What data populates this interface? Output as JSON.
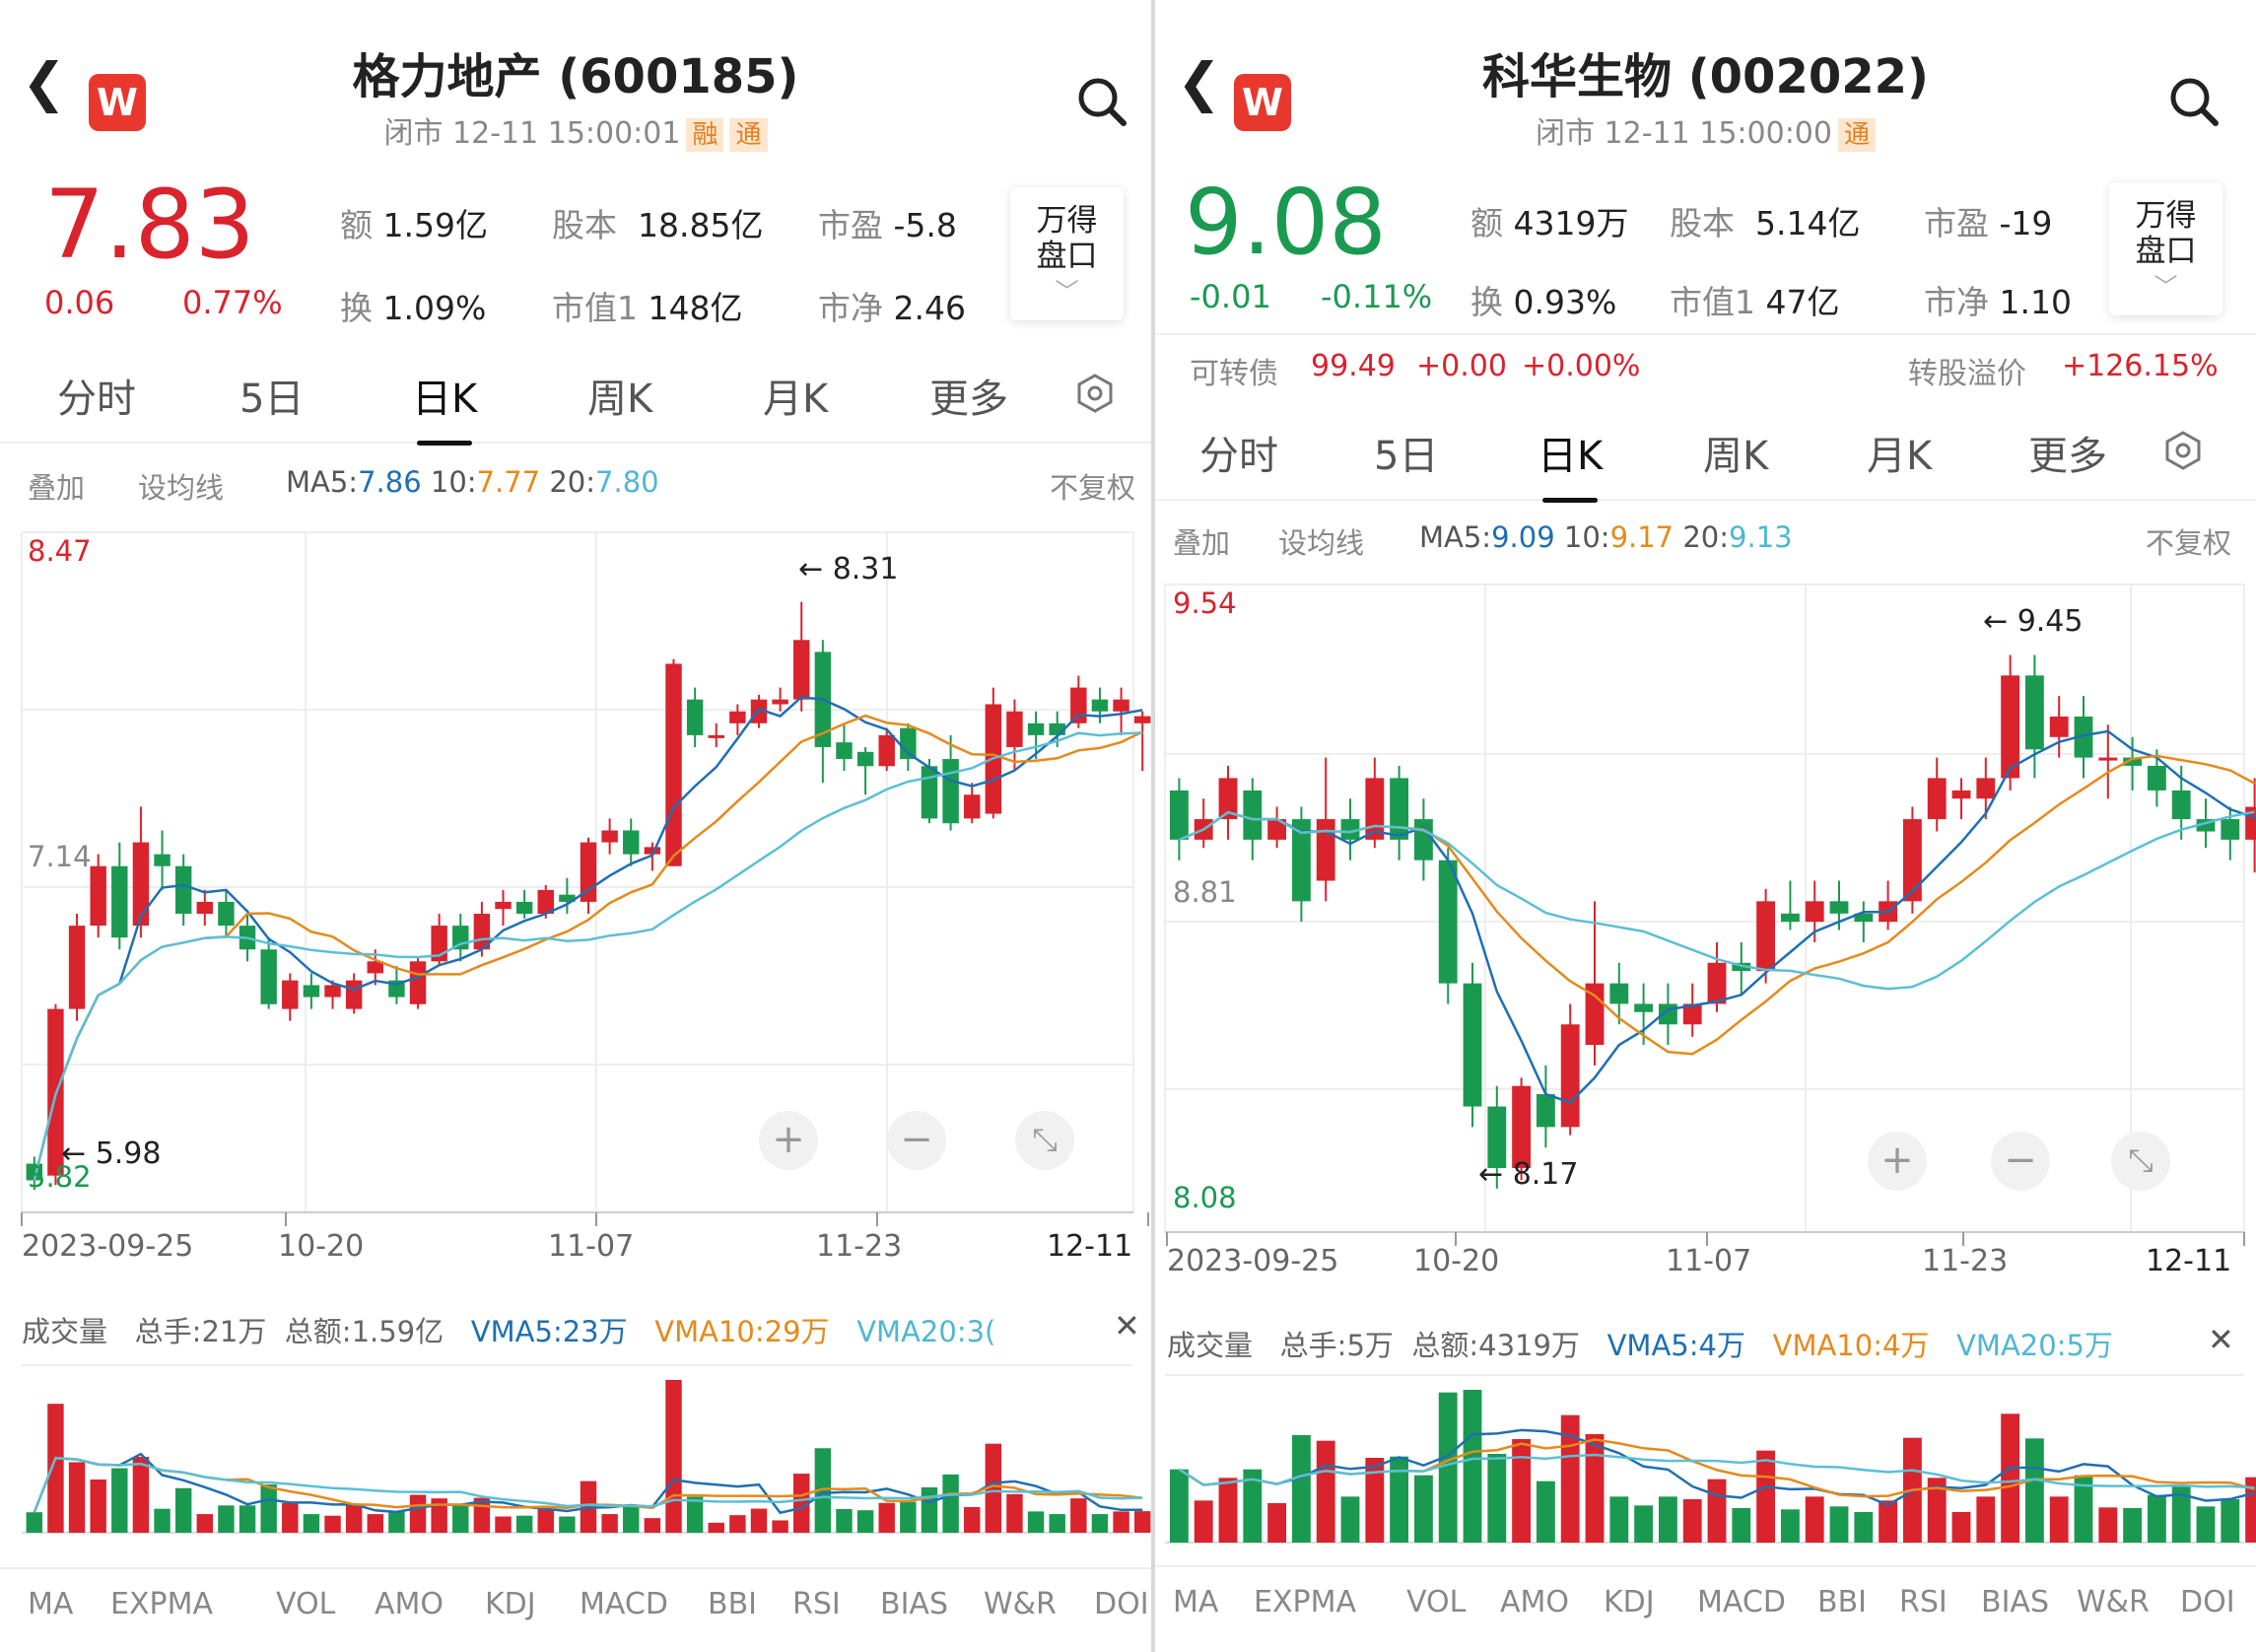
{
  "left": {
    "name": "格力地产 (600185)",
    "status": "闭市 12-11 15:00:01",
    "badges": [
      "融",
      "通"
    ],
    "price": "7.83",
    "chg": "0.06",
    "pct": "0.77%",
    "stats": [
      [
        "额",
        "1.59亿"
      ],
      [
        "股本",
        "18.85亿"
      ],
      [
        "市盈",
        "-5.8"
      ],
      [
        "换",
        "1.09%"
      ],
      [
        "市值1",
        "148亿"
      ],
      [
        "市净",
        "2.46"
      ]
    ],
    "side_btn": [
      "万得",
      "盘口"
    ],
    "tabs": [
      "分时",
      "5日",
      "日K",
      "周K",
      "月K",
      "更多"
    ],
    "sub": {
      "overlay": "叠加",
      "ma_set": "设均线",
      "ma5k": "MA5:",
      "ma5": "7.86",
      "ma10k": "10:",
      "ma10": "7.77",
      "ma20k": "20:",
      "ma20": "7.80",
      "adj": "不复权"
    },
    "axis": {
      "top": "8.47",
      "mid": "7.14",
      "bottom": "5.82"
    },
    "dates": [
      "2023-09-25",
      "10-20",
      "11-07",
      "11-23",
      "12-11"
    ],
    "annot_high": "8.31",
    "annot_low": "5.98",
    "vol": {
      "title": "成交量",
      "total": "总手:21万",
      "amount": "总额:1.59亿",
      "vma5": "VMA5:23万",
      "vma10": "VMA10:29万",
      "vma20": "VMA20:3("
    },
    "indicators": [
      "MA",
      "EXPMA",
      "VOL",
      "AMO",
      "KDJ",
      "MACD",
      "BBI",
      "RSI",
      "BIAS",
      "W&R",
      "DOI"
    ]
  },
  "right": {
    "name": "科华生物 (002022)",
    "status": "闭市 12-11 15:00:00",
    "badges": [
      "通"
    ],
    "price": "9.08",
    "chg": "-0.01",
    "pct": "-0.11%",
    "stats": [
      [
        "额",
        "4319万"
      ],
      [
        "股本",
        "5.14亿"
      ],
      [
        "市盈",
        "-19"
      ],
      [
        "换",
        "0.93%"
      ],
      [
        "市值1",
        "47亿"
      ],
      [
        "市净",
        "1.10"
      ]
    ],
    "side_btn": [
      "万得",
      "盘口"
    ],
    "bond": {
      "label": "可转债",
      "price": "99.49",
      "chg": "+0.00",
      "pct": "+0.00%",
      "prem_label": "转股溢价",
      "prem": "+126.15%"
    },
    "tabs": [
      "分时",
      "5日",
      "日K",
      "周K",
      "月K",
      "更多"
    ],
    "sub": {
      "overlay": "叠加",
      "ma_set": "设均线",
      "ma5k": "MA5:",
      "ma5": "9.09",
      "ma10k": "10:",
      "ma10": "9.17",
      "ma20k": "20:",
      "ma20": "9.13",
      "adj": "不复权"
    },
    "axis": {
      "top": "9.54",
      "mid": "8.81",
      "bottom": "8.08"
    },
    "dates": [
      "2023-09-25",
      "10-20",
      "11-07",
      "11-23",
      "12-11"
    ],
    "annot_high": "9.45",
    "annot_low": "8.17",
    "vol": {
      "title": "成交量",
      "total": "总手:5万",
      "amount": "总额:4319万",
      "vma5": "VMA5:4万",
      "vma10": "VMA10:4万",
      "vma20": "VMA20:5万"
    },
    "indicators": [
      "MA",
      "EXPMA",
      "VOL",
      "AMO",
      "KDJ",
      "MACD",
      "BBI",
      "RSI",
      "BIAS",
      "W&R",
      "DOI"
    ]
  },
  "colors": {
    "up": "#d9232d",
    "down": "#1a9a50",
    "ma5": "#1e6fb3",
    "ma10": "#e58a1b",
    "ma20": "#5bbfd6"
  },
  "chart_data": [
    {
      "type": "candlestick",
      "title": "格力地产 (600185)",
      "ylim": [
        5.82,
        8.47
      ],
      "candles": [
        [
          5.95,
          5.88,
          5.98,
          5.84
        ],
        [
          5.9,
          6.6,
          6.62,
          5.86
        ],
        [
          6.6,
          6.95,
          7.0,
          6.55
        ],
        [
          6.95,
          7.2,
          7.25,
          6.9
        ],
        [
          7.2,
          6.9,
          7.3,
          6.85
        ],
        [
          6.95,
          7.3,
          7.45,
          6.9
        ],
        [
          7.25,
          7.2,
          7.35,
          7.1
        ],
        [
          7.2,
          7.0,
          7.25,
          6.95
        ],
        [
          7.0,
          7.05,
          7.1,
          6.95
        ],
        [
          7.05,
          6.95,
          7.1,
          6.9
        ],
        [
          6.95,
          6.85,
          7.0,
          6.8
        ],
        [
          6.85,
          6.62,
          6.9,
          6.6
        ],
        [
          6.6,
          6.72,
          6.75,
          6.55
        ],
        [
          6.7,
          6.65,
          6.75,
          6.6
        ],
        [
          6.65,
          6.7,
          6.72,
          6.6
        ],
        [
          6.6,
          6.72,
          6.75,
          6.58
        ],
        [
          6.75,
          6.8,
          6.85,
          6.7
        ],
        [
          6.72,
          6.65,
          6.78,
          6.62
        ],
        [
          6.62,
          6.8,
          6.82,
          6.6
        ],
        [
          6.8,
          6.95,
          7.0,
          6.78
        ],
        [
          6.95,
          6.85,
          7.0,
          6.8
        ],
        [
          6.85,
          7.0,
          7.05,
          6.82
        ],
        [
          7.02,
          7.05,
          7.1,
          6.95
        ],
        [
          7.05,
          7.0,
          7.1,
          6.98
        ],
        [
          7.0,
          7.1,
          7.12,
          6.98
        ],
        [
          7.08,
          7.05,
          7.15,
          7.0
        ],
        [
          7.05,
          7.3,
          7.32,
          7.0
        ],
        [
          7.3,
          7.35,
          7.4,
          7.25
        ],
        [
          7.35,
          7.25,
          7.4,
          7.2
        ],
        [
          7.25,
          7.28,
          7.3,
          7.18
        ],
        [
          7.2,
          8.05,
          8.07,
          7.2
        ],
        [
          7.9,
          7.75,
          7.95,
          7.7
        ],
        [
          7.75,
          7.75,
          7.8,
          7.7
        ],
        [
          7.8,
          7.85,
          7.88,
          7.75
        ],
        [
          7.8,
          7.9,
          7.92,
          7.78
        ],
        [
          7.88,
          7.9,
          7.95,
          7.85
        ],
        [
          7.9,
          8.15,
          8.31,
          7.85
        ],
        [
          8.1,
          7.7,
          8.15,
          7.55
        ],
        [
          7.72,
          7.65,
          7.8,
          7.6
        ],
        [
          7.68,
          7.62,
          7.7,
          7.5
        ],
        [
          7.62,
          7.75,
          7.78,
          7.6
        ],
        [
          7.78,
          7.65,
          7.8,
          7.6
        ],
        [
          7.62,
          7.4,
          7.65,
          7.38
        ],
        [
          7.65,
          7.38,
          7.75,
          7.35
        ],
        [
          7.4,
          7.5,
          7.55,
          7.38
        ],
        [
          7.42,
          7.88,
          7.95,
          7.4
        ],
        [
          7.7,
          7.85,
          7.9,
          7.6
        ],
        [
          7.8,
          7.75,
          7.85,
          7.65
        ],
        [
          7.8,
          7.75,
          7.85,
          7.7
        ],
        [
          7.8,
          7.95,
          8.0,
          7.78
        ],
        [
          7.9,
          7.85,
          7.95,
          7.8
        ],
        [
          7.85,
          7.9,
          7.95,
          7.75
        ],
        [
          7.8,
          7.83,
          7.85,
          7.6
        ]
      ]
    },
    {
      "type": "candlestick",
      "title": "科华生物 (002022)",
      "ylim": [
        8.08,
        9.54
      ],
      "candles": [
        [
          9.12,
          9.0,
          9.15,
          8.95
        ],
        [
          9.0,
          9.05,
          9.1,
          8.98
        ],
        [
          9.05,
          9.15,
          9.18,
          9.0
        ],
        [
          9.12,
          9.0,
          9.15,
          8.95
        ],
        [
          9.0,
          9.05,
          9.08,
          8.98
        ],
        [
          9.05,
          8.85,
          9.08,
          8.8
        ],
        [
          8.9,
          9.05,
          9.2,
          8.85
        ],
        [
          9.05,
          9.0,
          9.1,
          8.95
        ],
        [
          9.0,
          9.15,
          9.2,
          8.98
        ],
        [
          9.15,
          9.0,
          9.18,
          8.95
        ],
        [
          9.05,
          8.95,
          9.1,
          8.9
        ],
        [
          8.95,
          8.65,
          8.98,
          8.6
        ],
        [
          8.65,
          8.35,
          8.7,
          8.3
        ],
        [
          8.35,
          8.2,
          8.4,
          8.15
        ],
        [
          8.2,
          8.4,
          8.42,
          8.17
        ],
        [
          8.38,
          8.3,
          8.45,
          8.25
        ],
        [
          8.3,
          8.55,
          8.6,
          8.28
        ],
        [
          8.5,
          8.65,
          8.85,
          8.45
        ],
        [
          8.65,
          8.6,
          8.7,
          8.55
        ],
        [
          8.6,
          8.58,
          8.65,
          8.5
        ],
        [
          8.6,
          8.55,
          8.65,
          8.5
        ],
        [
          8.55,
          8.6,
          8.65,
          8.52
        ],
        [
          8.6,
          8.7,
          8.75,
          8.58
        ],
        [
          8.7,
          8.68,
          8.75,
          8.62
        ],
        [
          8.68,
          8.85,
          8.88,
          8.65
        ],
        [
          8.82,
          8.8,
          8.9,
          8.78
        ],
        [
          8.8,
          8.85,
          8.9,
          8.75
        ],
        [
          8.85,
          8.82,
          8.9,
          8.78
        ],
        [
          8.82,
          8.8,
          8.85,
          8.75
        ],
        [
          8.8,
          8.85,
          8.9,
          8.78
        ],
        [
          8.85,
          9.05,
          9.08,
          8.82
        ],
        [
          9.05,
          9.15,
          9.2,
          9.02
        ],
        [
          9.1,
          9.12,
          9.15,
          9.05
        ],
        [
          9.1,
          9.15,
          9.2,
          9.05
        ],
        [
          9.15,
          9.4,
          9.45,
          9.12
        ],
        [
          9.4,
          9.22,
          9.45,
          9.15
        ],
        [
          9.25,
          9.3,
          9.35,
          9.2
        ],
        [
          9.3,
          9.2,
          9.35,
          9.15
        ],
        [
          9.2,
          9.2,
          9.28,
          9.1
        ],
        [
          9.2,
          9.18,
          9.25,
          9.12
        ],
        [
          9.18,
          9.12,
          9.22,
          9.08
        ],
        [
          9.12,
          9.05,
          9.18,
          9.0
        ],
        [
          9.05,
          9.02,
          9.1,
          8.98
        ],
        [
          9.05,
          9.0,
          9.08,
          8.95
        ],
        [
          9.0,
          9.08,
          9.15,
          8.92
        ]
      ]
    }
  ]
}
